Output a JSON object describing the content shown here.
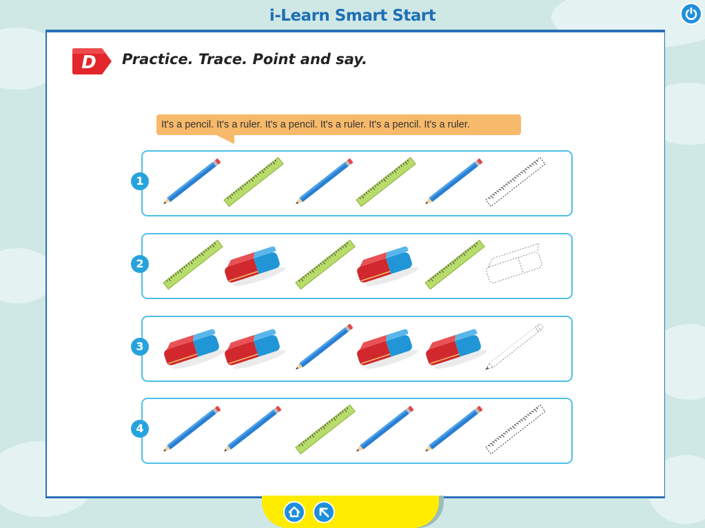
{
  "header": {
    "title": "i-Learn Smart Start"
  },
  "lesson": {
    "section_letter": "D",
    "instruction": "Practice. Trace. Point and say.",
    "speech_bubble": "It's a pencil. It's a ruler. It's a pencil. It's a ruler. It's a pencil. It's a ruler."
  },
  "rows": [
    {
      "number": "1",
      "items": [
        "pencil",
        "ruler",
        "pencil",
        "ruler",
        "pencil",
        "ruler-trace"
      ]
    },
    {
      "number": "2",
      "items": [
        "ruler",
        "eraser",
        "ruler",
        "eraser",
        "ruler",
        "eraser-trace"
      ]
    },
    {
      "number": "3",
      "items": [
        "eraser",
        "eraser",
        "pencil",
        "eraser",
        "eraser",
        "pencil-trace"
      ]
    },
    {
      "number": "4",
      "items": [
        "pencil",
        "pencil",
        "ruler",
        "pencil",
        "pencil",
        "ruler-trace"
      ]
    }
  ],
  "icons": {
    "power": "power-icon",
    "home": "home-icon",
    "back": "back-arrow-icon"
  },
  "colors": {
    "title_blue": "#1f6fb5",
    "badge_red": "#e3262b",
    "bubble_orange": "#f7b96a",
    "row_border": "#4cc0e6",
    "pencil_blue": "#2a7fd0",
    "ruler_green": "#b8dc6a",
    "eraser_red": "#d0282d",
    "eraser_blue": "#2196d6",
    "nav_yellow": "#ffec00"
  }
}
